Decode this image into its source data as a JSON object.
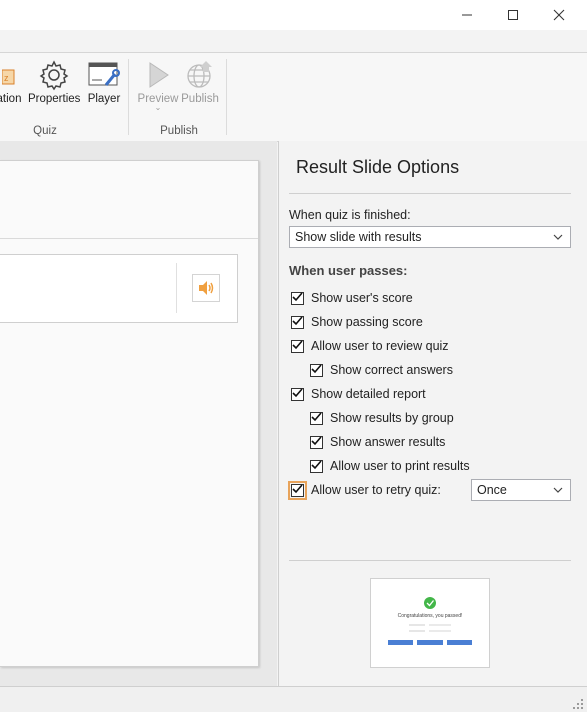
{
  "window": {
    "minimize": "minimize",
    "maximize": "maximize",
    "close": "close"
  },
  "ribbon": {
    "groups": {
      "quiz": {
        "label": "Quiz",
        "buttons": {
          "animation": "ation",
          "properties": "Properties",
          "player": "Player"
        }
      },
      "publish": {
        "label": "Publish",
        "buttons": {
          "preview": "Preview",
          "publish": "Publish"
        }
      }
    }
  },
  "panel": {
    "title": "Result Slide Options",
    "finish_label": "When quiz is finished:",
    "finish_value": "Show slide with results",
    "passes_label": "When user passes:",
    "options": {
      "show_score": "Show user's score",
      "show_passing": "Show passing score",
      "allow_review": "Allow user to review quiz",
      "show_correct": "Show correct answers",
      "show_report": "Show detailed report",
      "results_by_group": "Show results by group",
      "answer_results": "Show answer results",
      "allow_print": "Allow user to print results",
      "allow_retry": "Allow user to retry quiz:"
    },
    "retry_value": "Once",
    "preview": {
      "message": "Congratulations, you passed!"
    }
  },
  "colors": {
    "accent": "#4a7fd4",
    "check_green": "#43b649",
    "focus": "#e8a35a",
    "audio": "#f0a040"
  }
}
